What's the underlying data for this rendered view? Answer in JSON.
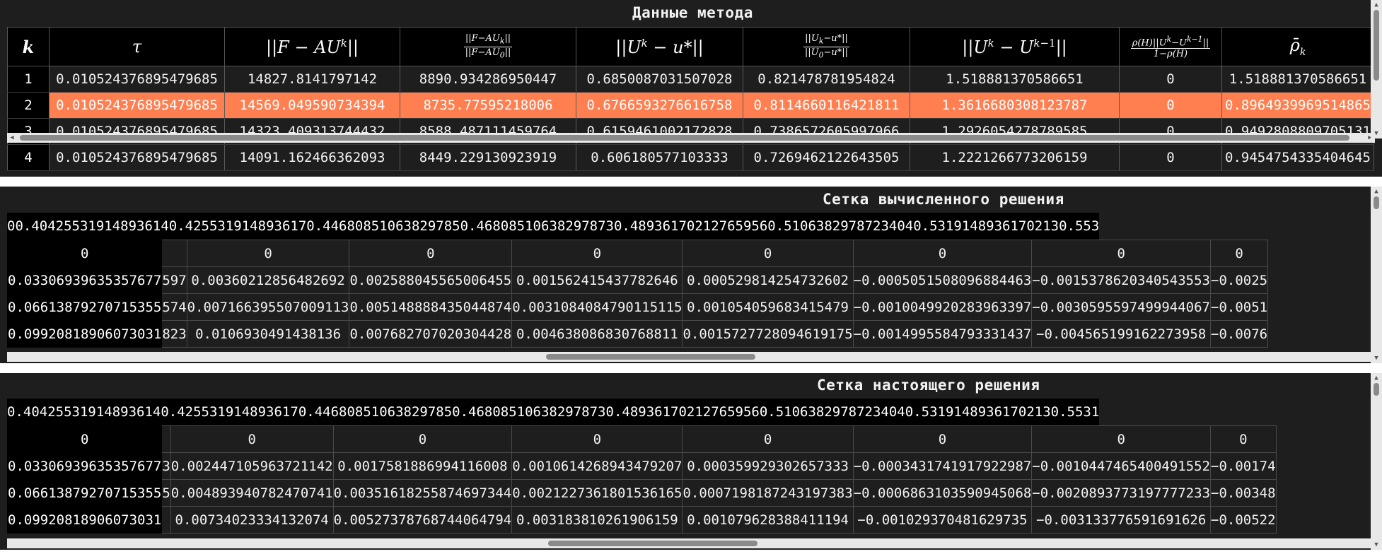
{
  "method_panel": {
    "title": "Данные метода",
    "headers": [
      "k",
      "τ",
      "||F − AU^k||",
      "||F−AU_k|| / ||F−AU_0||",
      "||U^k − u*||",
      "||U_k−u*|| / ||U_0−u*||",
      "||U^k − U^{k−1}||",
      "ρ(H)||U^k−U^{k−1}|| / 1−ρ(H)",
      "ρ̄_k"
    ],
    "rows": [
      [
        "1",
        "0.010524376895479685",
        "14827.8141797142",
        "8890.934286950447",
        "0.6850087031507028",
        "0.821478781954824",
        "1.518881370586651",
        "0",
        "1.518881370586651"
      ],
      [
        "2",
        "0.010524376895479685",
        "14569.049590734394",
        "8735.77595218006",
        "0.6766593276616758",
        "0.811466011642181​1",
        "1.3616680308123787",
        "0",
        "0.8964939969514865"
      ],
      [
        "3",
        "0.010524376895479685",
        "14323.409313744432",
        "8588.487111459764",
        "0.6159461002172828",
        "0.7386572605997966",
        "1.2926054278789585",
        "0",
        "0.9492808809705131"
      ],
      [
        "4",
        "0.010524376895479685",
        "14091.162466362093",
        "8449.229130923919",
        "0.606180577103333",
        "0.7269462122643505",
        "1.2221266773206159",
        "0",
        "0.9454754335404645"
      ]
    ],
    "selected_row": 2
  },
  "computed_panel": {
    "title": "Сетка вычисленного решения",
    "x_values": [
      "0",
      "0.40425531914893614",
      "0.425531914893617",
      "0.44680851063829785",
      "0.46808510638297873",
      "0.48936170212765956",
      "0.5106382978723404",
      "0.5319148936170213",
      "0.553"
    ],
    "row_labels": [
      "0",
      "0.03306939635357677",
      "0.06613879270715355",
      "0.09920818906073031"
    ],
    "cut_col": [
      "",
      "597",
      "574",
      "823"
    ],
    "cells": [
      [
        "0",
        "0",
        "0",
        "0",
        "0",
        "0",
        "0"
      ],
      [
        "0.00360212856482692",
        "0.002588045565006455",
        "0.001562415437782646",
        "0.000529814254732602",
        "−0.0005051508096884463",
        "−0.001537862034054355​3",
        "−0.0025"
      ],
      [
        "0.007166395507009113",
        "0.005148888435044874",
        "0.003108408479011511​5",
        "0.001054059683415479",
        "−0.0010049920283963397",
        "−0.0030595597499944067",
        "−0.0051"
      ],
      [
        "0.0106930491438136",
        "0.007682707020304428",
        "0.004638086830768811",
        "0.0015727728094619175",
        "−0.0014995584793331437",
        "−0.004565199162273958",
        "−0.0076"
      ]
    ]
  },
  "true_panel": {
    "title": "Сетка настоящего решения",
    "x_values": [
      "0.40425531914893614",
      "0.425531914893617",
      "0.44680851063829785",
      "0.46808510638297873",
      "0.48936170212765956",
      "0.5106382978723404",
      "0.5319148936170213",
      "0.5531"
    ],
    "row_labels": [
      "0",
      "0.03306939635357677",
      "0.06613879270715355",
      "0.09920818906073031"
    ],
    "cut_col": [
      "",
      "3",
      "5",
      ""
    ],
    "cells": [
      [
        "0",
        "0",
        "0",
        "0",
        "0",
        "0",
        "0"
      ],
      [
        "0.002447105963721142",
        "0.001758188699411600​8",
        "0.0010614268943479207",
        "0.00035992930265733​3",
        "−0.0003431741917922987",
        "−0.0010447465400491552",
        "−0.00174"
      ],
      [
        "0.004893940782470741",
        "0.0035161825587469734​4",
        "0.0021227361801536165",
        "0.0007198187243197383",
        "−0.0006863103590945068",
        "−0.0020893773197777233",
        "−0.00348"
      ],
      [
        "0.0073402333413207​4",
        "0.005273787687440647​94",
        "0.003183810261906159",
        "0.001079628388411194",
        "−0.0010293704816297​35",
        "−0.003133776591691626",
        "−0.00522"
      ]
    ]
  }
}
